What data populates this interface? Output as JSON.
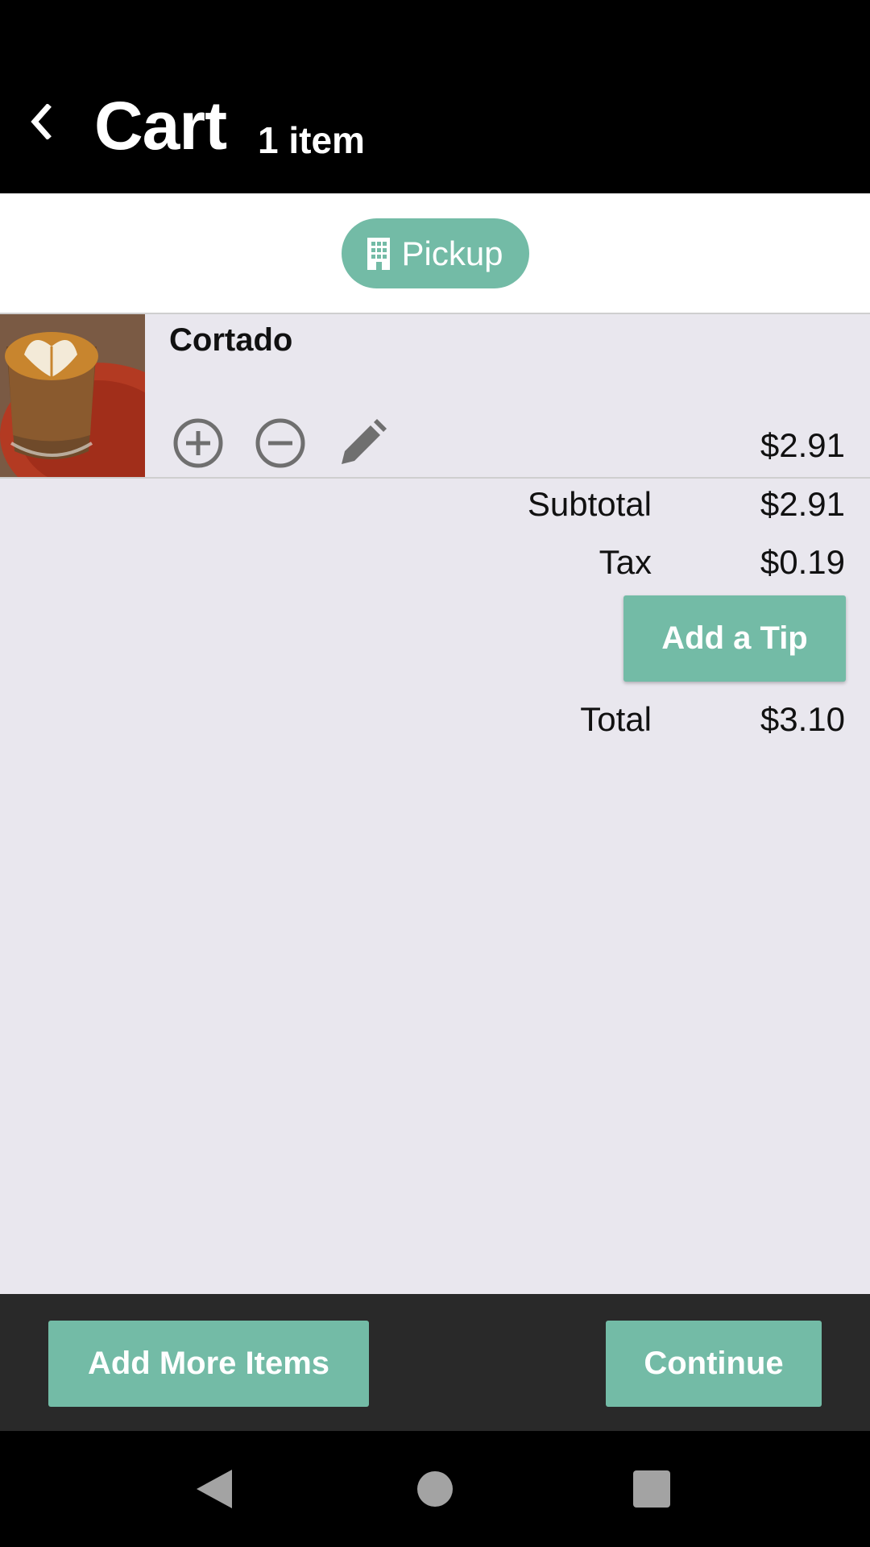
{
  "header": {
    "title": "Cart",
    "item_count": "1 item"
  },
  "order_mode": {
    "label": "Pickup",
    "icon": "building-icon"
  },
  "cart": {
    "items": [
      {
        "name": "Cortado",
        "price": "$2.91",
        "image": "cortado-latte-art-photo"
      }
    ]
  },
  "summary": {
    "subtotal_label": "Subtotal",
    "subtotal_value": "$2.91",
    "tax_label": "Tax",
    "tax_value": "$0.19",
    "tip_button": "Add a Tip",
    "total_label": "Total",
    "total_value": "$3.10"
  },
  "footer": {
    "add_more_label": "Add More Items",
    "continue_label": "Continue"
  },
  "colors": {
    "accent": "#73bba6",
    "background": "#e9e7ee",
    "header": "#000000",
    "footer": "#292929",
    "icon_gray": "#6f6f6f"
  }
}
